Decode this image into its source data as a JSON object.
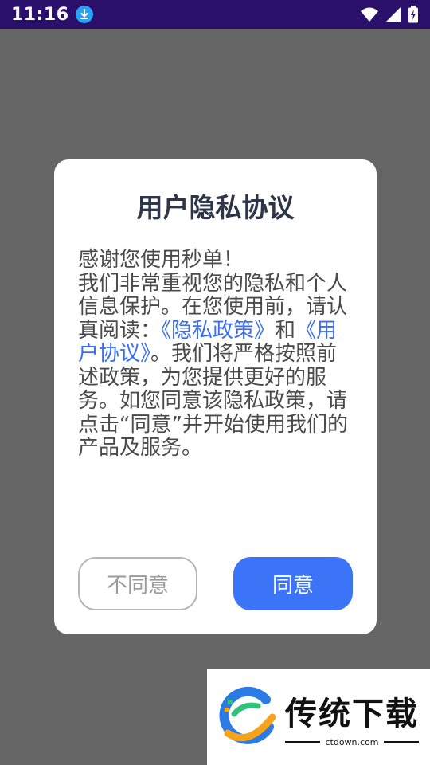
{
  "status_bar": {
    "time": "11:16",
    "icons": [
      "download-icon",
      "wifi-icon",
      "signal-icon",
      "battery-charging-icon"
    ]
  },
  "dialog": {
    "title": "用户隐私协议",
    "body": {
      "p1": "感谢您使用秒单！",
      "p2": "我们非常重视您的隐私和个人信息保护。在您使用前，请认真阅读：",
      "link_privacy": "《隐私政策》",
      "and": "和",
      "link_user_agreement": "《用户协议》",
      "p3": "。我们将严格按照前述政策，为您提供更好的服务。如您同意该隐私政策，请点击“同意”并开始使用我们的产品及服务。"
    },
    "decline_label": "不同意",
    "accept_label": "同意"
  },
  "watermark": {
    "title": "传统下载",
    "subtitle": "ctdown.com"
  },
  "colors": {
    "overlay": "#666666",
    "status_bar": "#2a0f6b",
    "accent": "#3b74f6",
    "link": "#3a6ef0",
    "title": "#2f3549"
  }
}
